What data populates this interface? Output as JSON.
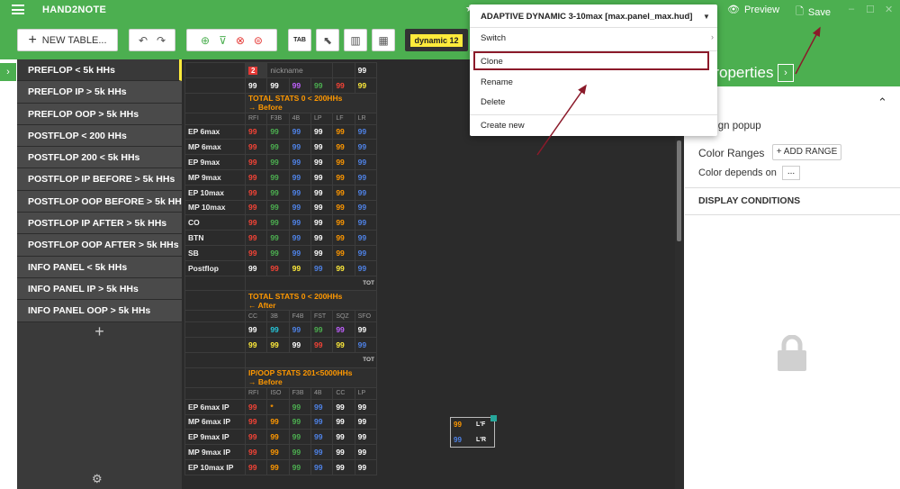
{
  "app": {
    "title": "HAND2NOTE",
    "preview": "Preview",
    "save": "Save"
  },
  "toolbar": {
    "new_table": "NEW TABLE...",
    "tab_label": "TAB",
    "dynamic_label": "dynamic 12"
  },
  "sidebar": {
    "items": [
      "PREFLOP < 5k HHs",
      "PREFLOP IP > 5k HHs",
      "PREFLOP OOP > 5k HHs",
      "POSTFLOP < 200 HHs",
      "POSTFLOP 200 < 5k HHs",
      "POSTFLOP IP BEFORE > 5k HHs",
      "POSTFLOP OOP BEFORE > 5k HHs",
      "POSTFLOP IP AFTER > 5k HHs",
      "POSTFLOP OOP AFTER > 5k HHs",
      "INFO PANEL < 5k HHs",
      "INFO PANEL IP > 5k HHs",
      "INFO PANEL OOP > 5k HHs"
    ],
    "add": "+"
  },
  "hud": {
    "badge": "2",
    "nickname": "nickname",
    "top_value": "99",
    "row2": [
      "99",
      "99",
      "99",
      "99",
      "99",
      "99"
    ],
    "section1": {
      "title": "TOTAL STATS 0 < 200HHs",
      "sub": "→ Before",
      "headers": [
        "RFI",
        "F3B",
        "4B",
        "LP",
        "LF",
        "LR"
      ],
      "rows": [
        {
          "label": "EP 6max",
          "values": [
            "99",
            "99",
            "99",
            "99",
            "99",
            "99"
          ]
        },
        {
          "label": "MP 6max",
          "values": [
            "99",
            "99",
            "99",
            "99",
            "99",
            "99"
          ]
        },
        {
          "label": "EP 9max",
          "values": [
            "99",
            "99",
            "99",
            "99",
            "99",
            "99"
          ]
        },
        {
          "label": "MP 9max",
          "values": [
            "99",
            "99",
            "99",
            "99",
            "99",
            "99"
          ]
        },
        {
          "label": "EP 10max",
          "values": [
            "99",
            "99",
            "99",
            "99",
            "99",
            "99"
          ]
        },
        {
          "label": "MP 10max",
          "values": [
            "99",
            "99",
            "99",
            "99",
            "99",
            "99"
          ]
        },
        {
          "label": "CO",
          "values": [
            "99",
            "99",
            "99",
            "99",
            "99",
            "99"
          ]
        },
        {
          "label": "BTN",
          "values": [
            "99",
            "99",
            "99",
            "99",
            "99",
            "99"
          ]
        },
        {
          "label": "SB",
          "values": [
            "99",
            "99",
            "99",
            "99",
            "99",
            "99"
          ]
        },
        {
          "label": "Postflop",
          "values": [
            "99",
            "99",
            "99",
            "99",
            "99",
            "99"
          ]
        }
      ],
      "tot": "TOT"
    },
    "section2": {
      "title": "TOTAL STATS 0 < 200HHs",
      "sub": "← After",
      "headers": [
        "CC",
        "3B",
        "F4B",
        "FST",
        "SQZ",
        "SFO"
      ],
      "rows": [
        [
          "99",
          "99",
          "99",
          "99",
          "99",
          "99"
        ],
        [
          "99",
          "99",
          "99",
          "99",
          "99",
          "99"
        ]
      ],
      "tot": "TOT"
    },
    "section3": {
      "title": "IP/OOP  STATS 201<5000HHs",
      "sub": "→ Before",
      "headers": [
        "RFI",
        "ISO",
        "F3B",
        "4B",
        "CC",
        "LP"
      ],
      "rows": [
        {
          "label": "EP 6max IP",
          "values": [
            "99",
            "*",
            "99",
            "99",
            "99",
            "99"
          ]
        },
        {
          "label": "MP 6max IP",
          "values": [
            "99",
            "99",
            "99",
            "99",
            "99",
            "99"
          ]
        },
        {
          "label": "EP 9max IP",
          "values": [
            "99",
            "99",
            "99",
            "99",
            "99",
            "99"
          ]
        },
        {
          "label": "MP 9max IP",
          "values": [
            "99",
            "99",
            "99",
            "99",
            "99",
            "99"
          ]
        },
        {
          "label": "EP 10max IP",
          "values": [
            "99",
            "99",
            "99",
            "99",
            "99",
            "99"
          ]
        }
      ]
    },
    "side_box": {
      "v1": "99",
      "v2": "99",
      "l1": "L'F",
      "l2": "L'R"
    }
  },
  "properties": {
    "title": "Properties",
    "assign_popup": "Assign popup",
    "color_ranges": "Color Ranges",
    "add_range": "+ ADD RANGE",
    "color_depends_on": "Color depends on",
    "dots": "...",
    "display_conditions": "DISPLAY CONDITIONS"
  },
  "menu": {
    "title": "ADAPTIVE DYNAMIC 3-10max [max.panel_max.hud]",
    "switch": "Switch",
    "clone": "Clone",
    "rename": "Rename",
    "delete": "Delete",
    "create_new": "Create new"
  },
  "colors": {
    "green": "#4caf50",
    "annotation": "#8b1a2a",
    "dark": "#2b2b2b"
  }
}
